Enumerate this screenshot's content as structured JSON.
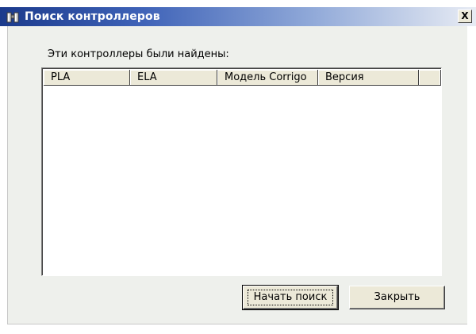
{
  "window": {
    "title": "Поиск контроллеров",
    "close_label": "X"
  },
  "main": {
    "found_label": "Эти контроллеры были найдены:",
    "columns": [
      "PLA",
      "ELA",
      "Модель Corrigo",
      "Версия"
    ],
    "rows": []
  },
  "buttons": {
    "start_search": "Начать поиск",
    "close": "Закрыть"
  },
  "icons": {
    "app": "binoculars-icon",
    "close": "close-icon"
  }
}
